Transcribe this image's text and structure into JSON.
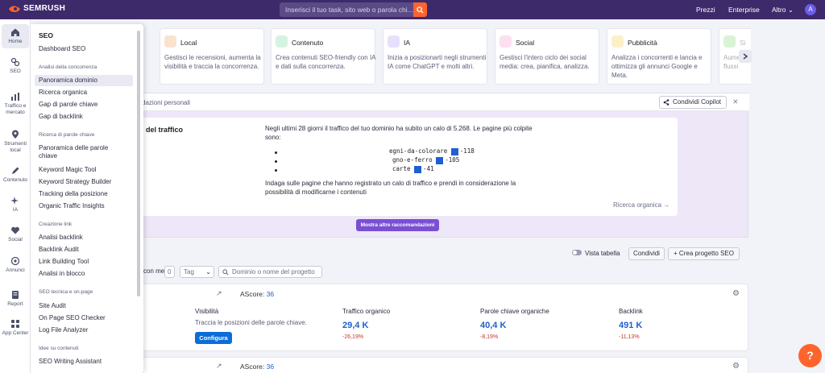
{
  "brand": {
    "name": "SEMRUSH",
    "accent": "#ff642d",
    "topbar_bg": "#3d2a6a"
  },
  "search": {
    "placeholder": "Inserisci il tuo task, sito web o parola chi..."
  },
  "topnav": {
    "prezzi": "Prezzi",
    "enterprise": "Enterprise",
    "altro": "Altro",
    "avatar": "A"
  },
  "rail": [
    {
      "label": "Home",
      "icon": "home-icon"
    },
    {
      "label": "SEO",
      "icon": "seo-icon"
    },
    {
      "label": "Traffico e mercato",
      "icon": "chart-icon"
    },
    {
      "label": "Strumenti local",
      "icon": "pin-icon"
    },
    {
      "label": "Contenuto",
      "icon": "pen-icon"
    },
    {
      "label": "IA",
      "icon": "sparkle-icon"
    },
    {
      "label": "Social",
      "icon": "heart-icon"
    },
    {
      "label": "Annunci",
      "icon": "target-icon"
    },
    {
      "label": "Report",
      "icon": "report-icon"
    },
    {
      "label": "App Center",
      "icon": "apps-icon"
    }
  ],
  "menu": {
    "title": "SEO",
    "dashboard": "Dashboard SEO",
    "h1": "Analisi della concorrenza",
    "i1": "Panoramica dominio",
    "i2": "Ricerca organica",
    "i3": "Gap di parole chiave",
    "i4": "Gap di backlink",
    "h2": "Ricerca di parole chiave",
    "i5": "Panoramica delle parole chiave",
    "i6": "Keyword Magic Tool",
    "i7": "Keyword Strategy Builder",
    "i8": "Tracking della posizione",
    "i9": "Organic Traffic Insights",
    "h3": "Creazione link",
    "i10": "Analisi backlink",
    "i11": "Backlink Audit",
    "i12": "Link Building Tool",
    "i13": "Analisi in blocco",
    "h4": "SEO tecnica e on-page",
    "i14": "Site Audit",
    "i15": "On Page SEO Checker",
    "i16": "Log File Analyzer",
    "h5": "Idee su contenuti",
    "i17": "SEO Writing Assistant"
  },
  "cards": [
    {
      "title": "Local",
      "desc": "Gestisci le recensioni, aumenta la visibilità e traccia la concorrenza.",
      "color": "#f9e3cf",
      "icon": "pin-icon"
    },
    {
      "title": "Contenuto",
      "desc": "Crea contenuti SEO-friendly con IA e dati sulla concorrenza.",
      "color": "#d6f2e3",
      "icon": "pen-icon"
    },
    {
      "title": "IA",
      "desc": "Inizia a posizionarti negli strumenti IA come ChatGPT e molti altri.",
      "color": "#e8e0fb",
      "icon": "sparkle-icon"
    },
    {
      "title": "Social",
      "desc": "Gestisci l'intero ciclo dei social media: crea, pianifica, analizza.",
      "color": "#fbe0ef",
      "icon": "heart-icon"
    },
    {
      "title": "Pubblicità",
      "desc": "Analizza i concorrenti e lancia e ottimizza gli annunci Google e Meta.",
      "color": "#fbf0c9",
      "icon": "target-icon"
    },
    {
      "title": "Si",
      "desc": "Aume e flussi",
      "color": "#daf3d6",
      "icon": "link-icon"
    }
  ],
  "recs": {
    "header": "dazioni personali",
    "copilot": "Condividi Copilot",
    "title": "del traffico",
    "para1": "Negli ultimi 28 giorni il traffico del tuo dominio ha subito un calo di 5.268. Le pagine più colpite sono:",
    "b1": "egni-da-colorare",
    "b1v": "-118",
    "b2": "gno-e-ferro",
    "b2v": "-105",
    "b3": "carte",
    "b3v": "-41",
    "para2": "Indaga sulle pagine che hanno registrato un calo di traffico e prendi in considerazione la possibilità di modificarne i contenuti",
    "link": "Ricerca organica →",
    "more": "Mostra altre raccomandazioni"
  },
  "toolbar": {
    "vista": "Vista tabella",
    "condividi": "Condividi",
    "crea": "+ Crea progetto SEO",
    "shared": "con me",
    "shared_count": "0",
    "tag": "Tag",
    "search_placeholder": "Dominio o nome del progetto"
  },
  "project1": {
    "ascore_label": "AScore:",
    "ascore": "36",
    "visibility_label": "Visibilità",
    "visibility_desc": "Traccia le posizioni delle parole chiave.",
    "configure": "Configura",
    "traffic_label": "Traffico organico",
    "traffic": "29,4 K",
    "traffic_delta": "-26,19%",
    "keywords_label": "Parole chiave organiche",
    "keywords": "40,4 K",
    "keywords_delta": "-8,19%",
    "backlink_label": "Backlink",
    "backlink": "491 K",
    "backlink_delta": "-11,13%"
  },
  "project2": {
    "ascore_label": "AScore:",
    "ascore": "36"
  },
  "help": "?"
}
